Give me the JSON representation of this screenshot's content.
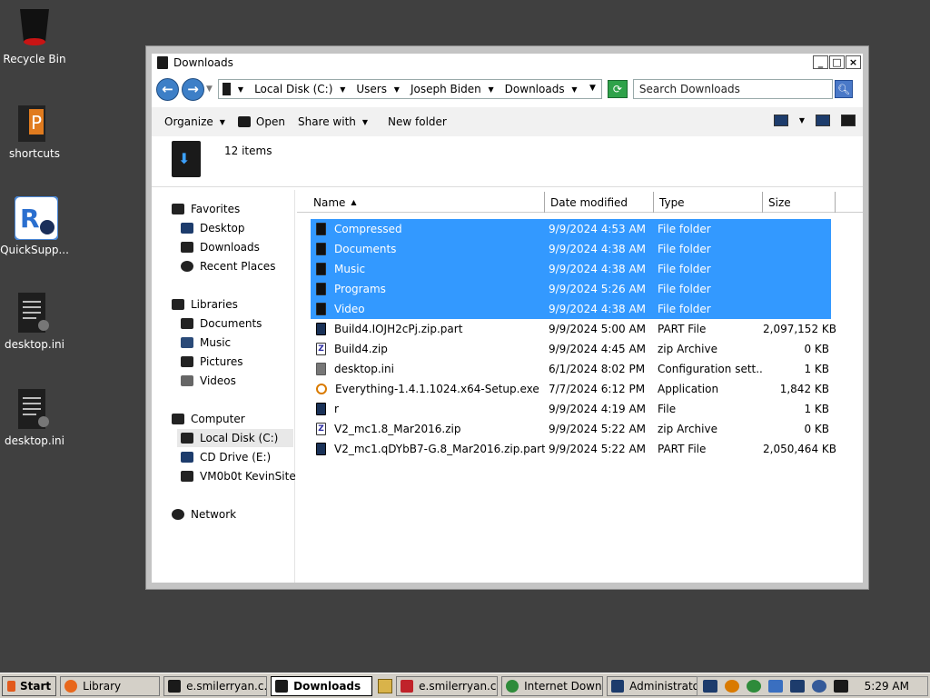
{
  "desktop": {
    "icons": [
      {
        "label": "Recycle Bin",
        "icon": "recycle-bin-icon"
      },
      {
        "label": "shortcuts",
        "icon": "shortcuts-folder-icon"
      },
      {
        "label": "QuickSupp...",
        "icon": "quicksupport-icon"
      },
      {
        "label": "desktop.ini",
        "icon": "ini-file-icon"
      },
      {
        "label": "desktop.ini",
        "icon": "ini-file-icon"
      }
    ]
  },
  "window": {
    "title": "Downloads",
    "buttons": {
      "minimize": "_",
      "maximize": "□",
      "close": "×"
    },
    "address": {
      "crumbs": [
        "Local Disk (C:)",
        "Users",
        "Joseph Biden",
        "Downloads"
      ]
    },
    "search": {
      "placeholder": "Search Downloads"
    },
    "toolbar": {
      "organize": "Organize",
      "open": "Open",
      "share_with": "Share with",
      "new_folder": "New folder"
    },
    "details": {
      "count": "12 items"
    },
    "nav": {
      "favorites": {
        "label": "Favorites",
        "items": [
          "Desktop",
          "Downloads",
          "Recent Places"
        ]
      },
      "libraries": {
        "label": "Libraries",
        "items": [
          "Documents",
          "Music",
          "Pictures",
          "Videos"
        ]
      },
      "computer": {
        "label": "Computer",
        "items": [
          "Local Disk (C:)",
          "CD Drive (E:)",
          "VM0b0t KevinSite"
        ]
      },
      "network": {
        "label": "Network"
      }
    },
    "columns": {
      "name": "Name",
      "date": "Date modified",
      "type": "Type",
      "size": "Size"
    },
    "files": [
      {
        "name": "Compressed",
        "date": "9/9/2024 4:53 AM",
        "type": "File folder",
        "size": "",
        "icon": "folder",
        "selected": true
      },
      {
        "name": "Documents",
        "date": "9/9/2024 4:38 AM",
        "type": "File folder",
        "size": "",
        "icon": "folder",
        "selected": true
      },
      {
        "name": "Music",
        "date": "9/9/2024 4:38 AM",
        "type": "File folder",
        "size": "",
        "icon": "folder",
        "selected": true
      },
      {
        "name": "Programs",
        "date": "9/9/2024 5:26 AM",
        "type": "File folder",
        "size": "",
        "icon": "folder",
        "selected": true
      },
      {
        "name": "Video",
        "date": "9/9/2024 4:38 AM",
        "type": "File folder",
        "size": "",
        "icon": "folder",
        "selected": true
      },
      {
        "name": "Build4.IOJH2cPj.zip.part",
        "date": "9/9/2024 5:00 AM",
        "type": "PART File",
        "size": "2,097,152 KB",
        "icon": "part",
        "selected": false
      },
      {
        "name": "Build4.zip",
        "date": "9/9/2024 4:45 AM",
        "type": "zip Archive",
        "size": "0 KB",
        "icon": "zip",
        "selected": false
      },
      {
        "name": "desktop.ini",
        "date": "6/1/2024 8:02 PM",
        "type": "Configuration sett...",
        "size": "1 KB",
        "icon": "ini",
        "selected": false
      },
      {
        "name": "Everything-1.4.1.1024.x64-Setup.exe",
        "date": "7/7/2024 6:12 PM",
        "type": "Application",
        "size": "1,842 KB",
        "icon": "exe",
        "selected": false
      },
      {
        "name": "r",
        "date": "9/9/2024 4:19 AM",
        "type": "File",
        "size": "1 KB",
        "icon": "file",
        "selected": false
      },
      {
        "name": "V2_mc1.8_Mar2016.zip",
        "date": "9/9/2024 5:22 AM",
        "type": "zip Archive",
        "size": "0 KB",
        "icon": "zip",
        "selected": false
      },
      {
        "name": "V2_mc1.qDYbB7-G.8_Mar2016.zip.part",
        "date": "9/9/2024 5:22 AM",
        "type": "PART File",
        "size": "2,050,464 KB",
        "icon": "part",
        "selected": false
      }
    ]
  },
  "taskbar": {
    "start": "Start",
    "items": [
      {
        "label": "Library",
        "active": false,
        "icon": "firefox-icon"
      },
      {
        "label": "e.smilerryan.c...",
        "active": false,
        "icon": "window-icon"
      },
      {
        "label": "Downloads",
        "active": true,
        "icon": "explorer-icon"
      },
      {
        "label": "e.smilerryan.c...",
        "active": false,
        "icon": "filezilla-icon"
      },
      {
        "label": "Internet Down...",
        "active": false,
        "icon": "idm-icon"
      },
      {
        "label": "Administrator:...",
        "active": false,
        "icon": "cmd-icon"
      }
    ],
    "clock": "5:29 AM"
  },
  "colors": {
    "selection": "#3399ff",
    "desktop": "#404040",
    "accent": "#3d7fc7"
  }
}
